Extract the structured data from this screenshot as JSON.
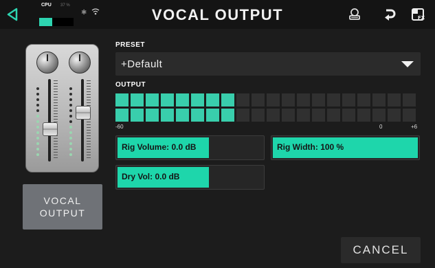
{
  "header": {
    "title": "VOCAL OUTPUT",
    "cpu_label": "CPU",
    "cpu_percent": "37 %",
    "cpu_load": 0.37,
    "icons": [
      "back-icon",
      "bluetooth-icon",
      "wifi-icon",
      "tuner-icon",
      "undo-icon",
      "fx-icon"
    ]
  },
  "left": {
    "module_button_label_line1": "VOCAL",
    "module_button_label_line2": "OUTPUT",
    "fader1_level": 0.38,
    "fader2_level": 0.62
  },
  "preset": {
    "label": "PRESET",
    "value": "+Default"
  },
  "output": {
    "label": "OUTPUT",
    "segments_total": 20,
    "lit_row1": 8,
    "lit_row2": 8,
    "scale_min": "-60",
    "scale_zero": "0",
    "scale_max": "+6"
  },
  "params": {
    "rig_volume": {
      "text": "Rig Volume: 0.0 dB",
      "level": 0.63
    },
    "rig_width": {
      "text": "Rig Width: 100 %",
      "level": 1.0
    },
    "dry_vol": {
      "text": "Dry Vol: 0.0 dB",
      "level": 0.63
    }
  },
  "cancel_label": "CANCEL",
  "colors": {
    "accent": "#1ed6ab",
    "meter_on": "#39ceac",
    "background": "#1c1c1c"
  }
}
